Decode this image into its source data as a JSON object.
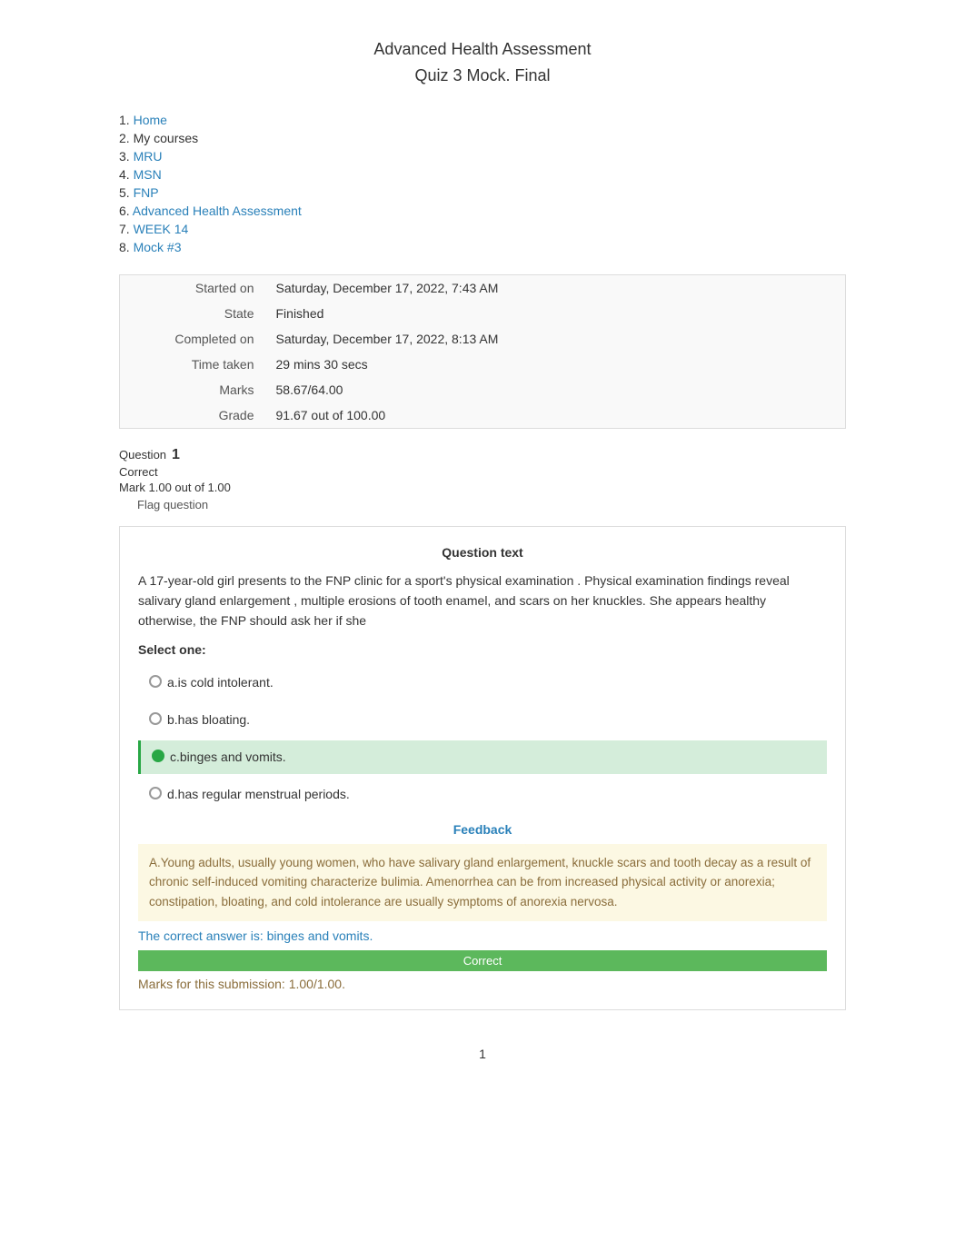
{
  "page": {
    "title_line1": "Advanced Health Assessment",
    "title_line2": "Quiz 3 Mock. Final"
  },
  "breadcrumb": {
    "items": [
      {
        "number": "1.",
        "label": "Home",
        "link": true
      },
      {
        "number": "2.",
        "label": "My courses",
        "link": false
      },
      {
        "number": "3.",
        "label": "MRU",
        "link": true
      },
      {
        "number": "4.",
        "label": "MSN",
        "link": true
      },
      {
        "number": "5.",
        "label": "FNP",
        "link": true
      },
      {
        "number": "6.",
        "label": "Advanced Health Assessment",
        "link": true
      },
      {
        "number": "7.",
        "label": "WEEK 14",
        "link": true
      },
      {
        "number": "8.",
        "label": "Mock #3",
        "link": true
      }
    ]
  },
  "quiz_info": {
    "rows": [
      {
        "label": "Started on",
        "value": "Saturday, December 17, 2022, 7:43 AM"
      },
      {
        "label": "State",
        "value": "Finished"
      },
      {
        "label": "Completed on",
        "value": "Saturday, December 17, 2022, 8:13 AM"
      },
      {
        "label": "Time taken",
        "value": "29 mins 30 secs"
      },
      {
        "label": "Marks",
        "value": "58.67/64.00"
      },
      {
        "label": "Grade",
        "value": "91.67 out of 100.00"
      }
    ]
  },
  "question": {
    "number": "1",
    "status": "Correct",
    "mark": "Mark 1.00 out of 1.00",
    "flag_label": "Flag question",
    "question_text_title": "Question text",
    "question_body": "A 17-year-old girl presents to the FNP clinic for a          sport's physical examination      . Physical examination findings reveal salivary gland enlargement , multiple erosions of tooth enamel, and scars on her knuckles. She appears healthy otherwise, the FNP should ask her if she",
    "select_one": "Select one:",
    "options": [
      {
        "id": "a",
        "label": "a.is cold intolerant.",
        "selected": false,
        "correct": false
      },
      {
        "id": "b",
        "label": "b.has bloating.",
        "selected": false,
        "correct": false
      },
      {
        "id": "c",
        "label": "c.binges and vomits.",
        "selected": true,
        "correct": true
      },
      {
        "id": "d",
        "label": "d.has regular menstrual periods.",
        "selected": false,
        "correct": false
      }
    ],
    "feedback_title": "Feedback",
    "feedback_text": "A.Young adults, usually young women, who have salivary gland enlargement, knuckle scars and tooth decay as a result of chronic self-induced vomiting characterize bulimia. Amenorrhea can be from increased physical activity or anorexia; constipation, bloating, and cold intolerance are usually symptoms of anorexia nervosa.",
    "correct_answer_line": "The correct answer is: binges and vomits.",
    "correct_banner": "Correct",
    "marks_submission": "Marks for this submission: 1.00/1.00."
  },
  "pagination": {
    "current": "1"
  }
}
